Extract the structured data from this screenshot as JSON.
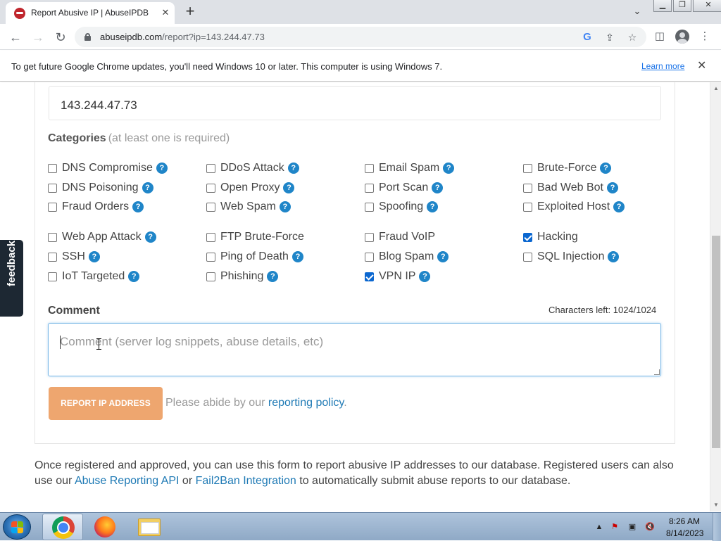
{
  "browser": {
    "tab_title": "Report Abusive IP | AbuseIPDB",
    "url_host": "abuseipdb.com",
    "url_path": "/report?ip=143.244.47.73",
    "new_tab_symbol": "+",
    "tab_close_symbol": "✕"
  },
  "infobar": {
    "message": "To get future Google Chrome updates, you'll need Windows 10 or later. This computer is using Windows 7.",
    "link": "Learn more"
  },
  "form": {
    "ip_value": "143.244.47.73",
    "categories_heading": "Categories",
    "categories_note": "(at least one is required)",
    "categories": [
      {
        "label": "DNS Compromise",
        "checked": false,
        "help": true
      },
      {
        "label": "DDoS Attack",
        "checked": false,
        "help": true
      },
      {
        "label": "Email Spam",
        "checked": false,
        "help": true
      },
      {
        "label": "Brute-Force",
        "checked": false,
        "help": true
      },
      {
        "label": "DNS Poisoning",
        "checked": false,
        "help": true
      },
      {
        "label": "Open Proxy",
        "checked": false,
        "help": true
      },
      {
        "label": "Port Scan",
        "checked": false,
        "help": true
      },
      {
        "label": "Bad Web Bot",
        "checked": false,
        "help": true
      },
      {
        "label": "Fraud Orders",
        "checked": false,
        "help": true
      },
      {
        "label": "Web Spam",
        "checked": false,
        "help": true
      },
      {
        "label": "Spoofing",
        "checked": false,
        "help": true
      },
      {
        "label": "Exploited Host",
        "checked": false,
        "help": true
      },
      {
        "label": "Web App Attack",
        "checked": false,
        "help": true
      },
      {
        "label": "FTP Brute-Force",
        "checked": false,
        "help": false
      },
      {
        "label": "Fraud VoIP",
        "checked": false,
        "help": false
      },
      {
        "label": "Hacking",
        "checked": true,
        "help": false
      },
      {
        "label": "SSH",
        "checked": false,
        "help": true
      },
      {
        "label": "Ping of Death",
        "checked": false,
        "help": true
      },
      {
        "label": "Blog Spam",
        "checked": false,
        "help": true
      },
      {
        "label": "SQL Injection",
        "checked": false,
        "help": true
      },
      {
        "label": "IoT Targeted",
        "checked": false,
        "help": true
      },
      {
        "label": "Phishing",
        "checked": false,
        "help": true
      },
      {
        "label": "VPN IP",
        "checked": true,
        "help": true
      }
    ],
    "help_symbol": "?",
    "comment_heading": "Comment",
    "characters_left": "Characters left: 1024/1024",
    "comment_placeholder": "Comment (server log snippets, abuse details, etc)",
    "comment_value": "",
    "submit_label": "REPORT IP ADDRESS",
    "policy_prefix": "Please abide by our ",
    "policy_link": "reporting policy",
    "policy_suffix": "."
  },
  "footer": {
    "part1": "Once registered and approved, you can use this form to report abusive IP addresses to our database. Registered users can also use our ",
    "link1": "Abuse Reporting API",
    "part2": " or ",
    "link2": "Fail2Ban Integration",
    "part3": " to automatically submit abuse reports to our database."
  },
  "feedback_label": "feedback",
  "taskbar": {
    "clock_time": "8:26 AM",
    "clock_date": "8/14/2023"
  },
  "colors": {
    "submit_button": "#eea66f",
    "link": "#1f7ab5",
    "help_icon": "#1f85c8",
    "checkbox_checked": "#0b67d0",
    "feedback_tab": "#1d2833"
  }
}
